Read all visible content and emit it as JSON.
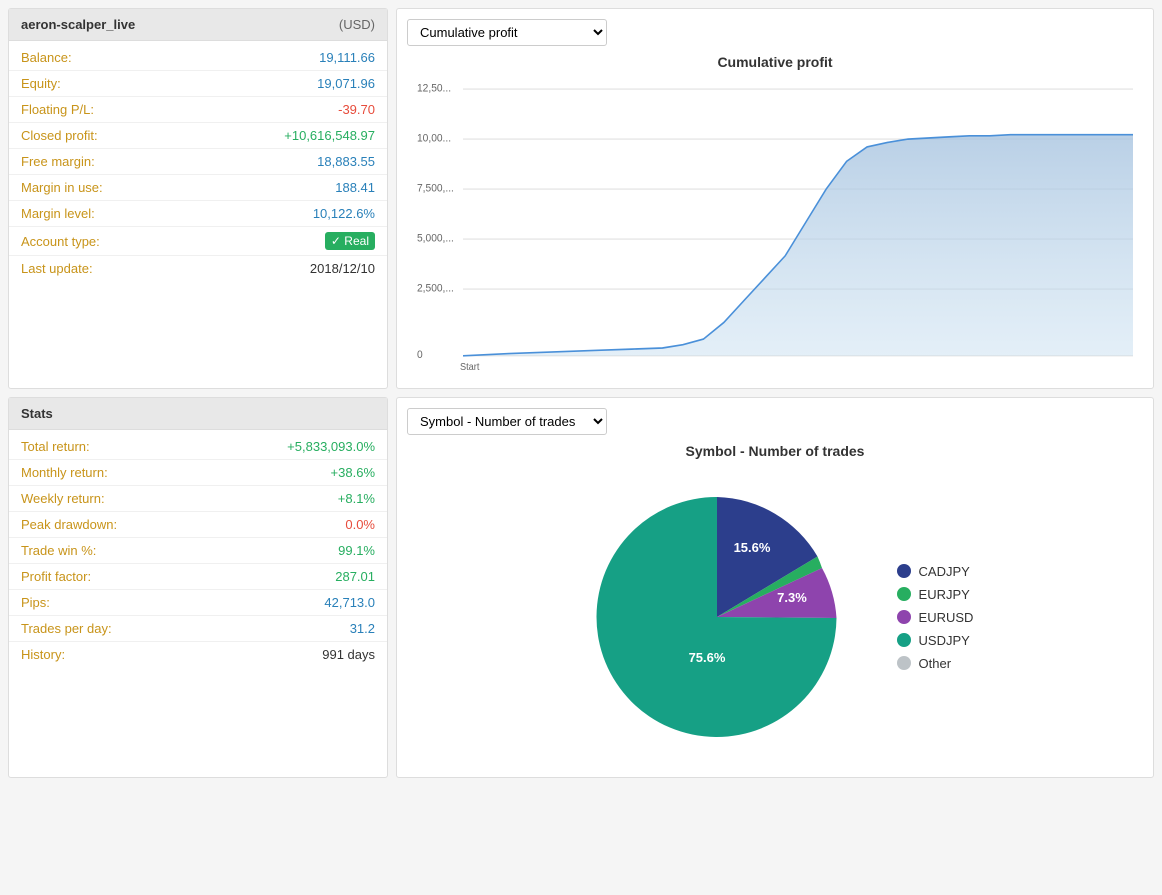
{
  "account": {
    "name": "aeron-scalper_live",
    "currency": "(USD)",
    "rows": [
      {
        "label": "Balance:",
        "value": "19,111.66",
        "style": "blue"
      },
      {
        "label": "Equity:",
        "value": "19,071.96",
        "style": "blue"
      },
      {
        "label": "Floating P/L:",
        "value": "-39.70",
        "style": "negative"
      },
      {
        "label": "Closed profit:",
        "value": "+10,616,548.97",
        "style": "positive"
      },
      {
        "label": "Free margin:",
        "value": "18,883.55",
        "style": "blue"
      },
      {
        "label": "Margin in use:",
        "value": "188.41",
        "style": "blue"
      },
      {
        "label": "Margin level:",
        "value": "10,122.6%",
        "style": "blue"
      },
      {
        "label": "Account type:",
        "value": "Real",
        "style": "badge"
      },
      {
        "label": "Last update:",
        "value": "2018/12/10",
        "style": "normal"
      }
    ]
  },
  "stats": {
    "header": "Stats",
    "rows": [
      {
        "label": "Total return:",
        "value": "+5,833,093.0%",
        "style": "positive"
      },
      {
        "label": "Monthly return:",
        "value": "+38.6%",
        "style": "positive"
      },
      {
        "label": "Weekly return:",
        "value": "+8.1%",
        "style": "positive"
      },
      {
        "label": "Peak drawdown:",
        "value": "0.0%",
        "style": "negative"
      },
      {
        "label": "Trade win %:",
        "value": "99.1%",
        "style": "positive"
      },
      {
        "label": "Profit factor:",
        "value": "287.01",
        "style": "positive"
      },
      {
        "label": "Pips:",
        "value": "42,713.0",
        "style": "blue"
      },
      {
        "label": "Trades per day:",
        "value": "31.2",
        "style": "blue"
      },
      {
        "label": "History:",
        "value": "991 days",
        "style": "normal"
      }
    ]
  },
  "cumulative_chart": {
    "dropdown_label": "Cumulative profit",
    "title": "Cumulative profit",
    "y_labels": [
      "12,50...",
      "10,00...",
      "7,500,...",
      "5,000,...",
      "2,500,...",
      "0"
    ],
    "x_label_start": "Start"
  },
  "pie_chart": {
    "dropdown_label": "Symbol - Number of trades",
    "title": "Symbol - Number of trades",
    "segments": [
      {
        "label": "CADJPY",
        "color": "#2c3e8c",
        "percentage": 15.6,
        "display": "15.6%"
      },
      {
        "label": "EURJPY",
        "color": "#27ae60",
        "percentage": 1.5,
        "display": ""
      },
      {
        "label": "EURUSD",
        "color": "#8e44ad",
        "percentage": 7.3,
        "display": "7.3%"
      },
      {
        "label": "USDJPY",
        "color": "#16a085",
        "percentage": 75.6,
        "display": "75.6%"
      },
      {
        "label": "Other",
        "color": "#bdc3c7",
        "percentage": 0.0,
        "display": ""
      }
    ]
  }
}
